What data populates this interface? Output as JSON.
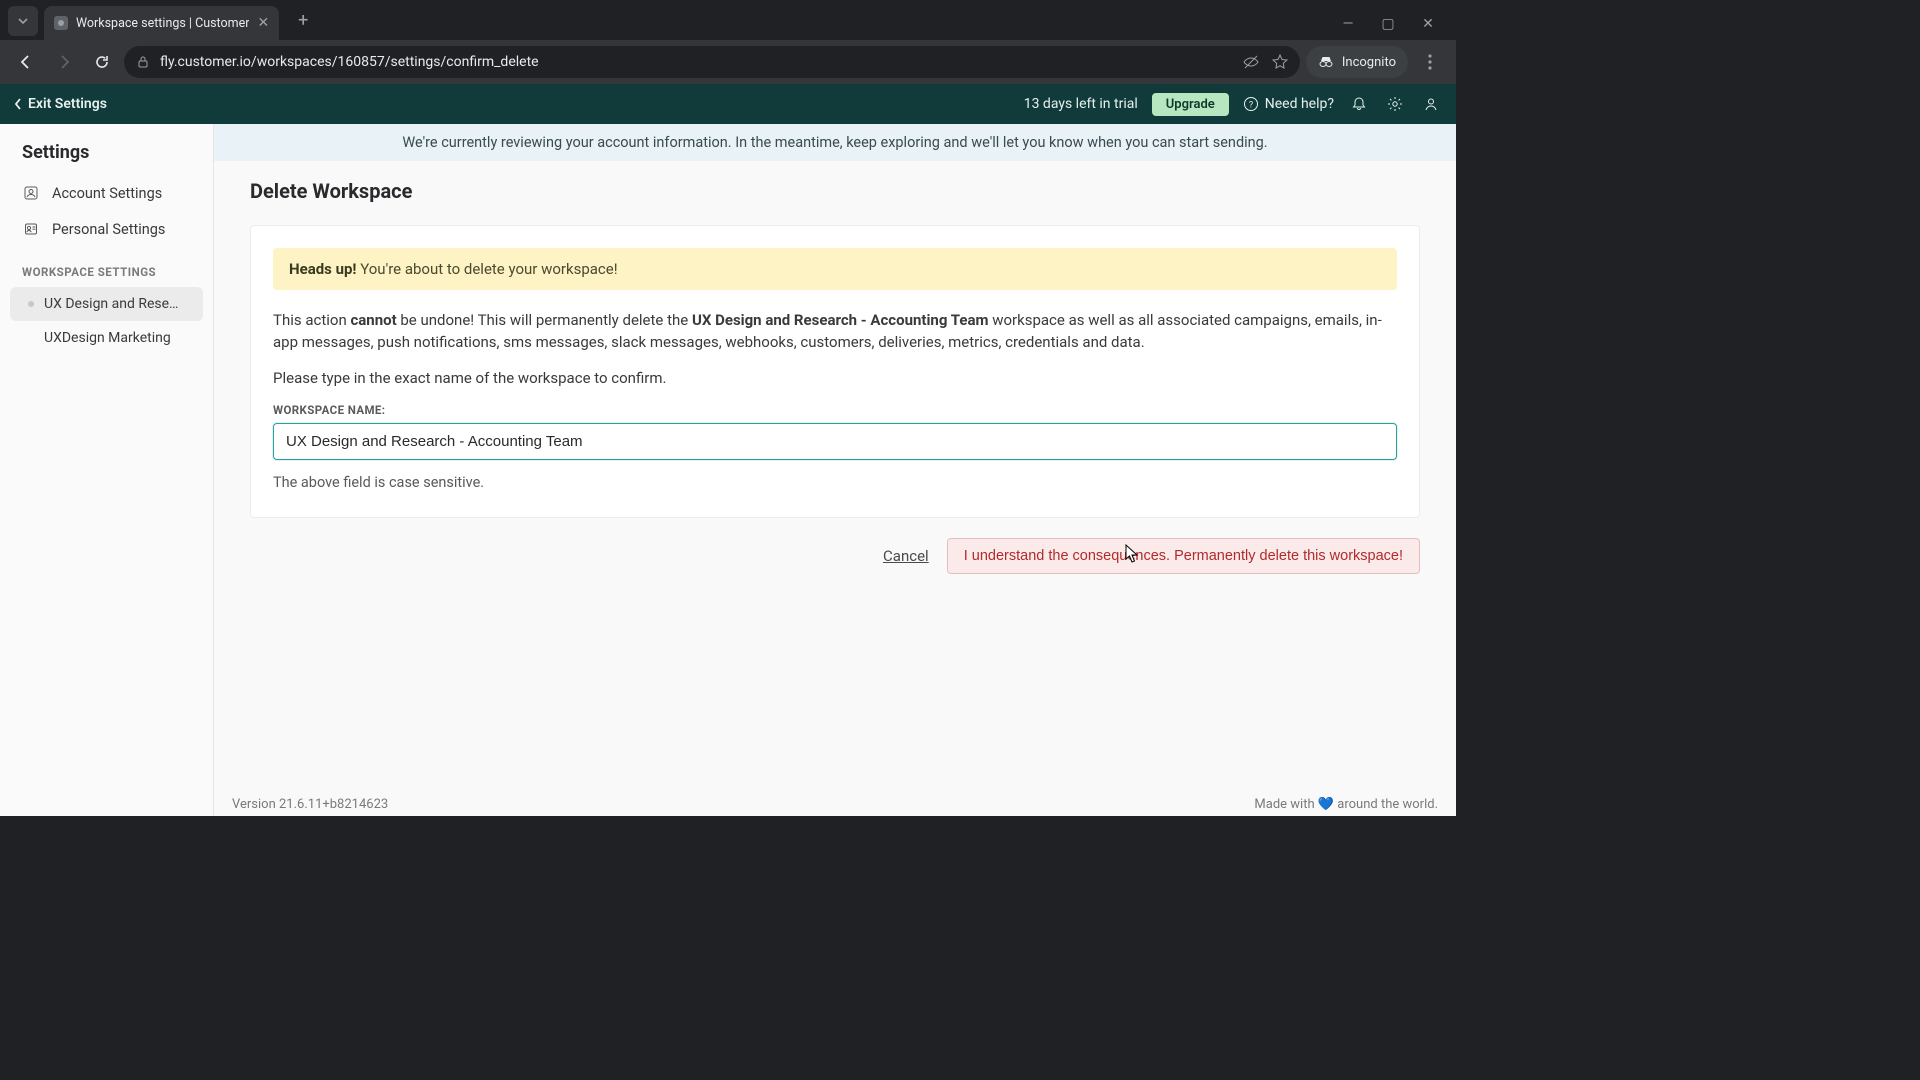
{
  "browser": {
    "tab_title": "Workspace settings | Customer",
    "url": "fly.customer.io/workspaces/160857/settings/confirm_delete",
    "incognito_label": "Incognito"
  },
  "topbar": {
    "exit_label": "Exit Settings",
    "trial_text": "13 days left in trial",
    "upgrade_label": "Upgrade",
    "need_help_label": "Need help?"
  },
  "sidebar": {
    "title": "Settings",
    "account_label": "Account Settings",
    "personal_label": "Personal Settings",
    "section_label": "WORKSPACE SETTINGS",
    "ws_active": "UX Design and Rese…",
    "ws_other": "UXDesign Marketing"
  },
  "banner": {
    "text": "We're currently reviewing your account information. In the meantime, keep exploring and we'll let you know when you can start sending."
  },
  "page": {
    "title": "Delete Workspace",
    "warn_strong": "Heads up!",
    "warn_rest": " You're about to delete your workspace!",
    "p1_pre": "This action ",
    "p1_cannot": "cannot",
    "p1_mid": " be undone! This will permanently delete the ",
    "p1_ws": "UX Design and Research - Accounting Team",
    "p1_post": " workspace as well as all associated campaigns, emails, in-app messages, push notifications, sms messages, slack messages, webhooks, customers, deliveries, metrics, credentials and data.",
    "p2": "Please type in the exact name of the workspace to confirm.",
    "field_label": "WORKSPACE NAME:",
    "input_value": "UX Design and Research - Accounting Team",
    "hint": "The above field is case sensitive.",
    "cancel_label": "Cancel",
    "confirm_label": "I understand the consequences. Permanently delete this workspace!"
  },
  "footer": {
    "version": "Version 21.6.11+b8214623",
    "made_pre": "Made with ",
    "made_post": " around the world."
  }
}
